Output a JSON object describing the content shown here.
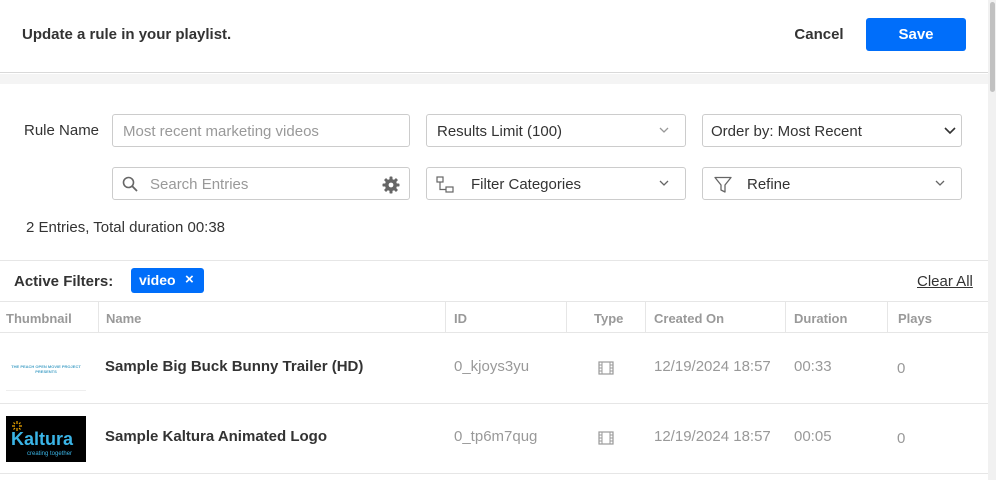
{
  "header": {
    "title": "Update a rule in your playlist.",
    "cancel_label": "Cancel",
    "save_label": "Save"
  },
  "form": {
    "rule_name_label": "Rule Name",
    "rule_name_placeholder": "Most recent marketing videos",
    "results_limit": "Results Limit (100)",
    "order_by": "Order by: Most Recent",
    "search_placeholder": "Search Entries",
    "filter_categories": "Filter Categories",
    "refine": "Refine"
  },
  "summary": "2 Entries, Total duration 00:38",
  "active_filters": {
    "label": "Active Filters:",
    "chips": [
      {
        "label": "video",
        "remove": "×"
      }
    ],
    "clear_all": "Clear All"
  },
  "table": {
    "columns": [
      "Thumbnail",
      "Name",
      "ID",
      "Type",
      "Created On",
      "Duration",
      "Plays"
    ],
    "rows": [
      {
        "thumbnail_text": "THE PEACH OPEN MOVIE PROJECT PRESENTS",
        "name": "Sample Big Buck Bunny Trailer (HD)",
        "id": "0_kjoys3yu",
        "type_icon": "film-icon",
        "created_on": "12/19/2024 18:57",
        "duration": "00:33",
        "plays": "0"
      },
      {
        "thumbnail_text": "Kaltura",
        "thumbnail_subtext": "creating together",
        "name": "Sample Kaltura Animated Logo",
        "id": "0_tp6m7qug",
        "type_icon": "film-icon",
        "created_on": "12/19/2024 18:57",
        "duration": "00:05",
        "plays": "0"
      }
    ]
  },
  "colors": {
    "accent": "#006efa",
    "muted_text": "#999999",
    "border": "#cccccc"
  }
}
